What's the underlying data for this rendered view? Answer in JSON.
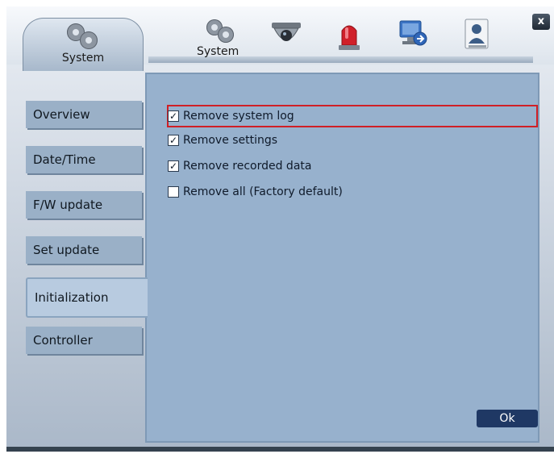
{
  "header": {
    "main_tab_label": "System",
    "close_label": "x",
    "toolbar": [
      {
        "name": "system",
        "label": "System",
        "icon": "gear-icon"
      },
      {
        "name": "camera",
        "label": "",
        "icon": "camera-icon"
      },
      {
        "name": "alarm",
        "label": "",
        "icon": "alarm-icon"
      },
      {
        "name": "network",
        "label": "",
        "icon": "network-icon"
      },
      {
        "name": "user",
        "label": "",
        "icon": "user-icon"
      }
    ]
  },
  "sidebar": {
    "items": [
      {
        "label": "Overview",
        "active": false
      },
      {
        "label": "Date/Time",
        "active": false
      },
      {
        "label": "F/W update",
        "active": false
      },
      {
        "label": "Set update",
        "active": false
      },
      {
        "label": "Initialization",
        "active": true
      },
      {
        "label": "Controller",
        "active": false
      }
    ]
  },
  "options": [
    {
      "label": "Remove system log",
      "checked": true,
      "highlighted": true
    },
    {
      "label": "Remove settings",
      "checked": true,
      "highlighted": false
    },
    {
      "label": "Remove recorded data",
      "checked": true,
      "highlighted": false
    },
    {
      "label": "Remove all (Factory default)",
      "checked": false,
      "highlighted": false
    }
  ],
  "ok_label": "Ok",
  "colors": {
    "panel": "#97b1cd",
    "highlight": "#d01f26",
    "ok_button": "#1f3864"
  }
}
